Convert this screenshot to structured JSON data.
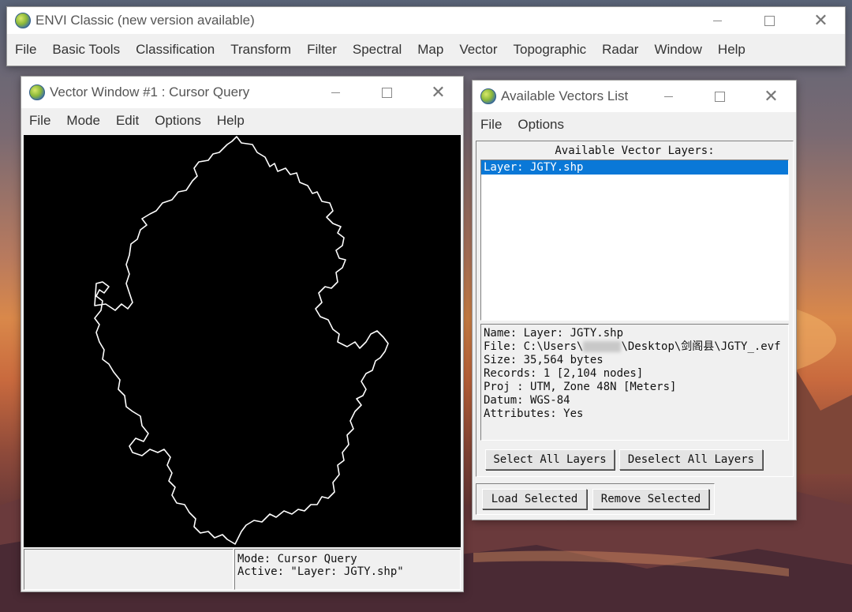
{
  "colors": {
    "selection": "#0a78d7",
    "canvas": "#000000",
    "vector_line": "#ffffff"
  },
  "main_window": {
    "title": "ENVI Classic (new version available)",
    "icon": "envi-icon",
    "menu": [
      "File",
      "Basic Tools",
      "Classification",
      "Transform",
      "Filter",
      "Spectral",
      "Map",
      "Vector",
      "Topographic",
      "Radar",
      "Window",
      "Help"
    ]
  },
  "vector_window": {
    "title": "Vector Window #1 : Cursor Query",
    "icon": "envi-icon",
    "menu": [
      "File",
      "Mode",
      "Edit",
      "Options",
      "Help"
    ],
    "status_mode": "Mode: Cursor Query",
    "status_active": "Active: \"Layer: JGTY.shp\""
  },
  "vectors_list": {
    "title": "Available Vectors List",
    "icon": "envi-icon",
    "menu": [
      "File",
      "Options"
    ],
    "group_label": "Available Vector Layers:",
    "layers": [
      "Layer: JGTY.shp"
    ],
    "selected_index": 0,
    "info": {
      "name": "Name: Layer: JGTY.shp",
      "file_prefix": "File: C:\\Users\\",
      "file_suffix": "\\Desktop\\剑阁县\\JGTY_.evf",
      "size": "Size: 35,564 bytes",
      "records": "Records: 1 [2,104 nodes]",
      "proj": "Proj : UTM, Zone 48N [Meters]",
      "datum": "Datum: WGS-84",
      "attributes": "Attributes: Yes"
    },
    "buttons": {
      "select_all": "Select All Layers",
      "deselect_all": "Deselect All Layers",
      "load_selected": "Load Selected",
      "remove_selected": "Remove Selected"
    }
  }
}
